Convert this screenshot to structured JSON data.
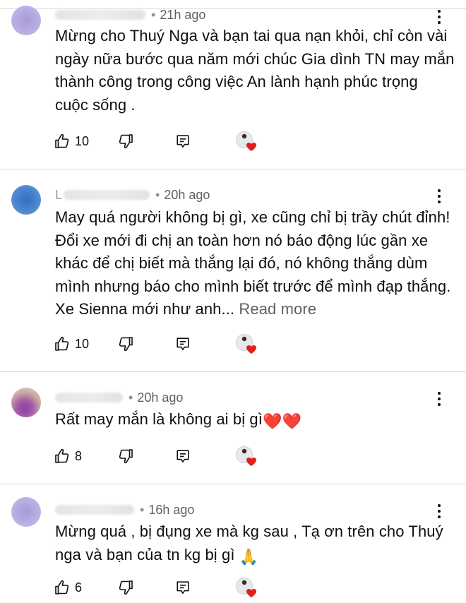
{
  "comments": [
    {
      "name_initial": "",
      "time": "21h ago",
      "text": "Mừng cho Thuý Nga và bạn tai qua nạn khỏi, chỉ còn vài ngày nữa bước qua năm mới chúc Gia dình TN may mắn thành công trong công việc An lành hạnh phúc trọng cuộc sống .",
      "read_more": "",
      "likes": "10",
      "avatar": "purple"
    },
    {
      "name_initial": "L",
      "time": "20h ago",
      "text": "May quá người không bị gì, xe cũng chỉ bị trầy chút đỉnh! Đổi xe mới đi chị an toàn hơn nó báo động lúc gần xe khác để chị biết mà thắng lại đó, nó không thắng dùm mình nhưng báo cho mình biết trước để mình đạp thắng. Xe Sienna mới như anh...",
      "read_more": "Read more",
      "likes": "10",
      "avatar": "blue"
    },
    {
      "name_initial": "",
      "time": "20h ago",
      "text": "Rất may mắn là không ai bị gì",
      "emoji_after": "❤️❤️",
      "read_more": "",
      "likes": "8",
      "avatar": "photo"
    },
    {
      "name_initial": "",
      "time": "16h ago",
      "text": "Mừng quá , bị đụng xe mà kg sau , Tạ ơn trên cho Thuý nga và bạn của tn kg bị gì",
      "emoji_after": "🙏",
      "read_more": "",
      "likes": "6",
      "avatar": "purple"
    }
  ],
  "colors": {
    "text": "#0f0f0f",
    "meta": "#606060",
    "divider": "#d9d9d9",
    "heart": "#e0201b"
  },
  "icons": [
    "thumbs-up-icon",
    "thumbs-down-icon",
    "reply-comment-icon",
    "creator-heart-icon",
    "more-vertical-icon"
  ]
}
